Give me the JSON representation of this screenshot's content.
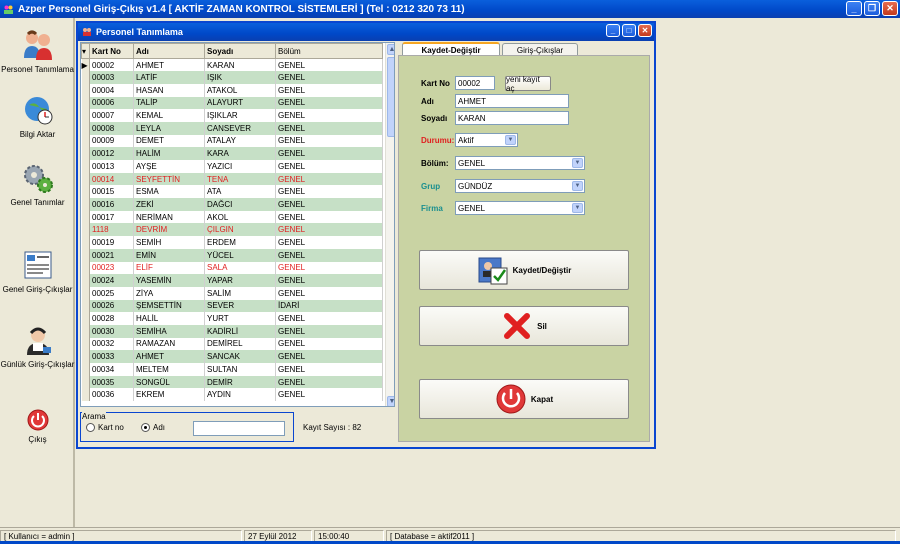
{
  "app": {
    "title": "Azper Personel Giriş-Çıkış v1.4 [ AKTİF ZAMAN KONTROL  SİSTEMLERİ  ] (Tel : 0212 320 73 11)"
  },
  "nav": [
    {
      "label": "Personel Tanımlama",
      "icon": "people-icon"
    },
    {
      "label": "Bilgi Aktar",
      "icon": "globe-clock-icon"
    },
    {
      "label": "Genel Tanımlar",
      "icon": "gears-icon"
    },
    {
      "label": "Genel Giriş-Çıkışlar",
      "icon": "report-icon"
    },
    {
      "label": "Günlük Giriş-Çıkışlar",
      "icon": "operator-icon"
    },
    {
      "label": "Çıkış",
      "icon": "power-icon"
    }
  ],
  "window": {
    "title": "Personel Tanımlama"
  },
  "grid": {
    "columns": [
      "Kart No",
      "Adı",
      "Soyadı",
      "Bölüm"
    ],
    "rows": [
      [
        "00002",
        "AHMET",
        "KARAN",
        "GENEL"
      ],
      [
        "00003",
        "LATİF",
        "IŞIK",
        "GENEL"
      ],
      [
        "00004",
        "HASAN",
        "ATAKOL",
        "GENEL"
      ],
      [
        "00006",
        "TALİP",
        "ALAYURT",
        "GENEL"
      ],
      [
        "00007",
        "KEMAL",
        "IŞIKLAR",
        "GENEL"
      ],
      [
        "00008",
        "LEYLA",
        "CANSEVER",
        "GENEL"
      ],
      [
        "00009",
        "DEMET",
        "ATALAY",
        "GENEL"
      ],
      [
        "00012",
        "HALİM",
        "KARA",
        "GENEL"
      ],
      [
        "00013",
        "AYŞE",
        "YAZICI",
        "GENEL"
      ],
      [
        "00014",
        "SEYFETTİN",
        "TENA",
        "GENEL"
      ],
      [
        "00015",
        "ESMA",
        "ATA",
        "GENEL"
      ],
      [
        "00016",
        "ZEKİ",
        "DAĞCI",
        "GENEL"
      ],
      [
        "00017",
        "NERİMAN",
        "AKOL",
        "GENEL"
      ],
      [
        "1118",
        "DEVRİM",
        "ÇILGIN",
        "GENEL"
      ],
      [
        "00019",
        "SEMİH",
        "ERDEM",
        "GENEL"
      ],
      [
        "00021",
        "EMİN",
        "YÜCEL",
        "GENEL"
      ],
      [
        "00023",
        "ELİF",
        "SALA",
        "GENEL"
      ],
      [
        "00024",
        "YASEMİN",
        "YAPAR",
        "GENEL"
      ],
      [
        "00025",
        "ZİYA",
        "SALİM",
        "GENEL"
      ],
      [
        "00026",
        "ŞEMSETTİN",
        "SEVER",
        "İDARİ"
      ],
      [
        "00028",
        "HALİL",
        "YURT",
        "GENEL"
      ],
      [
        "00030",
        "SEMİHA",
        "KADİRLİ",
        "GENEL"
      ],
      [
        "00032",
        "RAMAZAN",
        "DEMİREL",
        "GENEL"
      ],
      [
        "00033",
        "AHMET",
        "SANCAK",
        "GENEL"
      ],
      [
        "00034",
        "MELTEM",
        "SULTAN",
        "GENEL"
      ],
      [
        "00035",
        "SONGÜL",
        "DEMİR",
        "GENEL"
      ],
      [
        "00036",
        "EKREM",
        "AYDIN",
        "GENEL"
      ]
    ],
    "red_rows": [
      9,
      13,
      16
    ]
  },
  "search": {
    "title": "Arama",
    "opt_kart": "Kart no",
    "opt_adi": "Adı",
    "value": ""
  },
  "count_label": "Kayıt Sayısı :  82",
  "tabs": [
    "Kaydet-Değiştir",
    "Giriş-Çıkışlar"
  ],
  "form": {
    "kart_label": "Kart No",
    "kart_value": "00002",
    "new_btn": "yeni kayıt aç",
    "adi_label": "Adı",
    "adi_value": "AHMET",
    "soyadi_label": "Soyadı",
    "soyadi_value": "KARAN",
    "durumu_label": "Durumu:",
    "durumu_value": "Aktif",
    "bolum_label": "Bölüm:",
    "bolum_value": "GENEL",
    "grup_label": "Grup",
    "grup_value": "GÜNDÜZ",
    "firma_label": "Firma",
    "firma_value": "GENEL"
  },
  "buttons": {
    "save": "Kaydet/Değiştir",
    "delete": "Sil",
    "close": "Kapat"
  },
  "status": {
    "user": "[ Kullanıcı = admin ]",
    "date": "27 Eylül 2012",
    "time": "15:00:40",
    "db": "[ Database = aktif2011 ]"
  },
  "colors": {
    "accent": "#0048c8",
    "row_alt": "#c6e0c6",
    "panel": "#c9d3a3",
    "red": "#e02020",
    "teal_label": "#1a8f8f"
  }
}
